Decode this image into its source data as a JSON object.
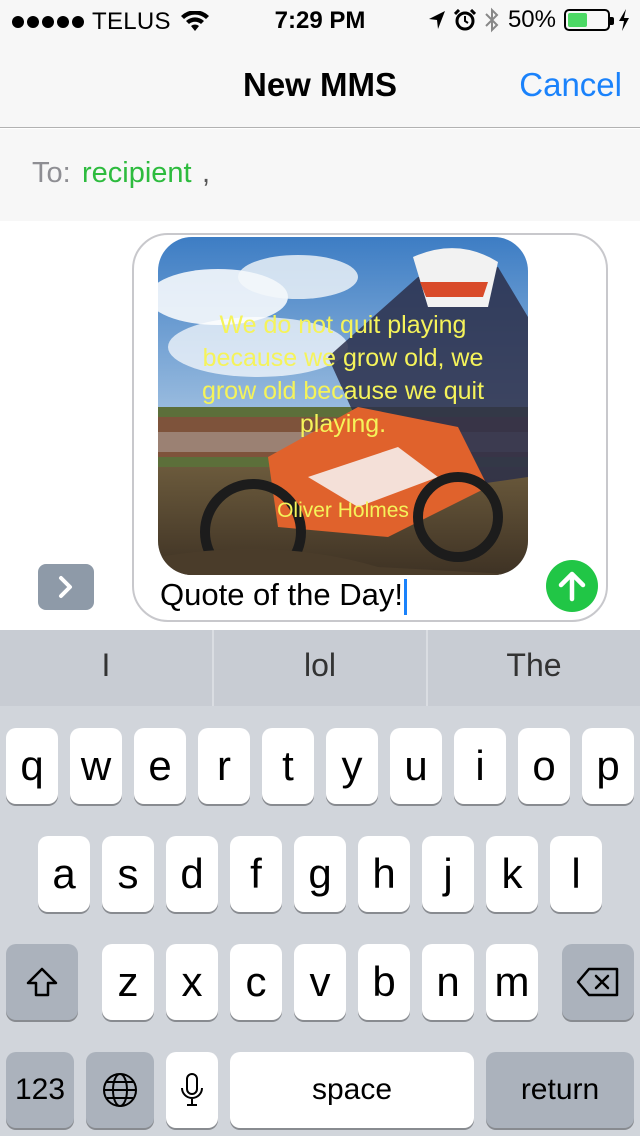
{
  "status_bar": {
    "carrier": "TELUS",
    "time": "7:29 PM",
    "battery_percent": "50%",
    "battery_level": 0.5,
    "icons": [
      "signal-dots",
      "wifi-icon",
      "location-arrow-icon",
      "alarm-icon",
      "bluetooth-icon",
      "battery-icon",
      "charging-bolt-icon"
    ]
  },
  "nav": {
    "title": "New MMS",
    "cancel_label": "Cancel"
  },
  "to_field": {
    "label": "To:",
    "recipient": "recipient",
    "separator": ","
  },
  "compose": {
    "image_quote": "We do not quit playing because we grow old, we grow old because we quit playing.",
    "image_author": "Oliver Holmes",
    "message_text": "Quote of the Day!",
    "colors": {
      "send_button": "#21c646",
      "quote_text": "#f5f35a",
      "recipient": "#2dbb3e",
      "accent": "#1a82fb"
    }
  },
  "keyboard": {
    "suggestions": [
      "I",
      "lol",
      "The"
    ],
    "row1": [
      "q",
      "w",
      "e",
      "r",
      "t",
      "y",
      "u",
      "i",
      "o",
      "p"
    ],
    "row2": [
      "a",
      "s",
      "d",
      "f",
      "g",
      "h",
      "j",
      "k",
      "l"
    ],
    "row3": [
      "z",
      "x",
      "c",
      "v",
      "b",
      "n",
      "m"
    ],
    "numbers_label": "123",
    "space_label": "space",
    "return_label": "return"
  }
}
